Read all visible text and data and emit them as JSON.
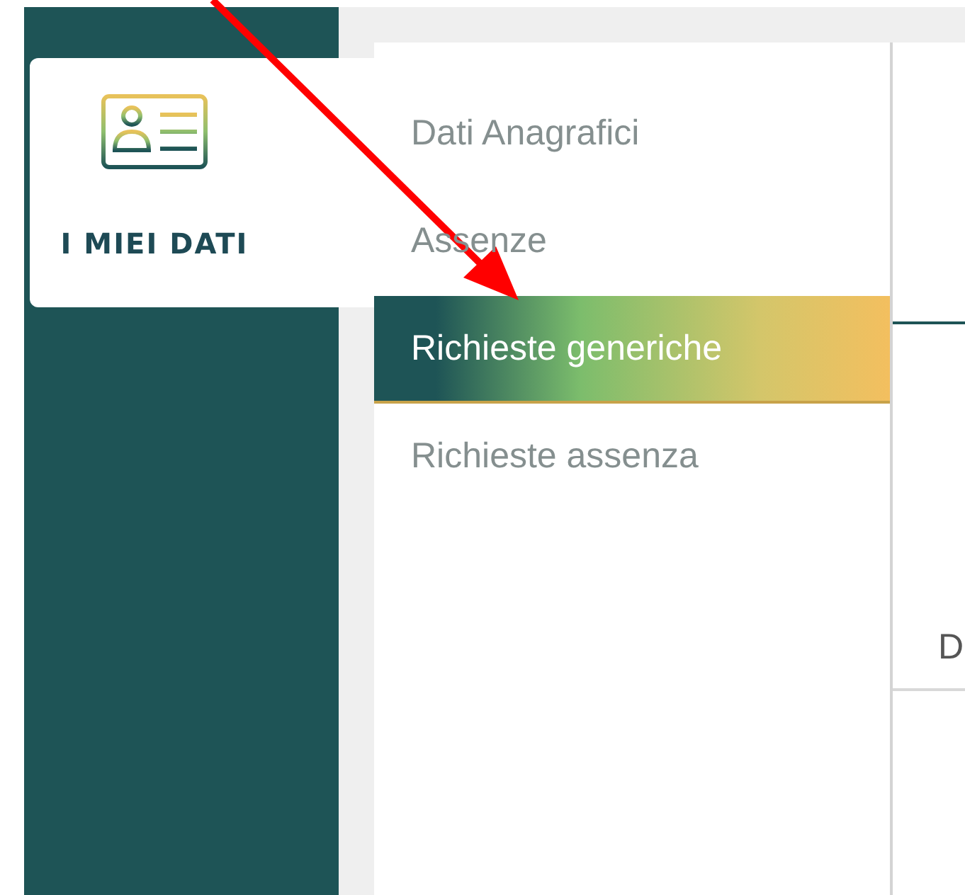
{
  "sidebar": {
    "card": {
      "label": "I MIEI DATI",
      "selected": true
    }
  },
  "submenu": {
    "items": [
      {
        "label": "Dati Anagrafici",
        "selected": false
      },
      {
        "label": "Assenze",
        "selected": false
      },
      {
        "label": "Richieste generiche",
        "selected": true
      },
      {
        "label": "Richieste assenza",
        "selected": false
      }
    ]
  },
  "content": {
    "table": {
      "column_1": "D"
    }
  },
  "annotation": {
    "kind": "arrow"
  }
}
